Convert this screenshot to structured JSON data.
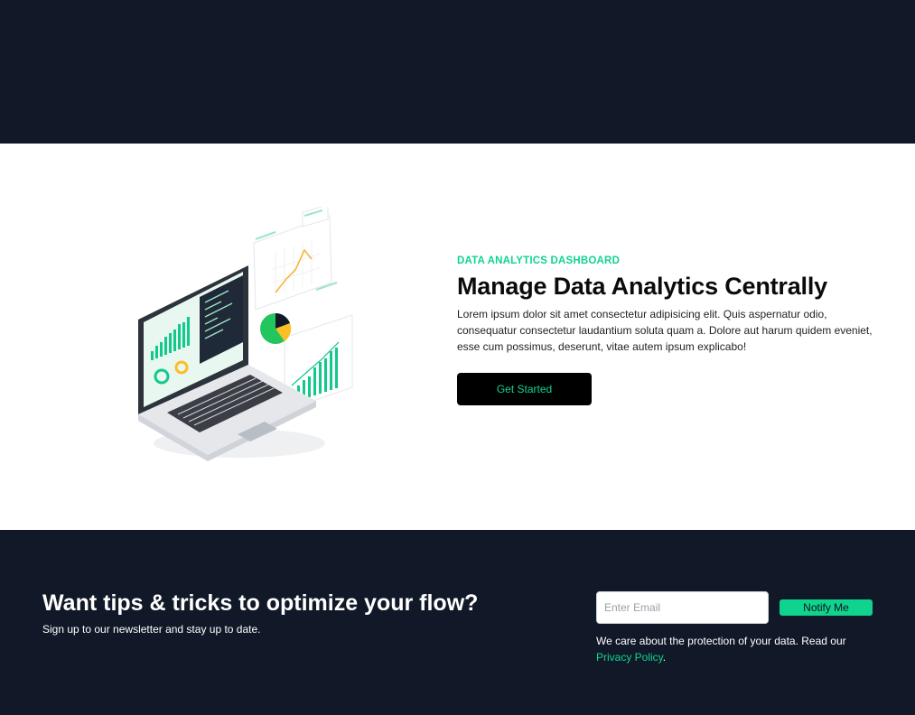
{
  "hero": {
    "eyebrow": "DATA ANALYTICS DASHBOARD",
    "title": "Manage Data Analytics Centrally",
    "description": "Lorem ipsum dolor sit amet consectetur adipisicing elit. Quis aspernatur odio, consequatur consectetur laudantium soluta quam a. Dolore aut harum quidem eveniet, esse cum possimus, deserunt, vitae autem ipsum explicabo!",
    "cta_label": "Get Started",
    "illustration_icon": "laptop-analytics-illustration"
  },
  "newsletter": {
    "title": "Want tips & tricks to optimize your flow?",
    "subtitle": "Sign up to our newsletter and stay up to date.",
    "email_placeholder": "Enter Email",
    "button_label": "Notify Me",
    "privacy_text": "We care about the protection of your data. Read our ",
    "privacy_link": "Privacy Policy",
    "privacy_end": "."
  },
  "colors": {
    "accent": "#10d48e",
    "dark_bg": "#111827",
    "hero_bg": "#ffffff"
  }
}
